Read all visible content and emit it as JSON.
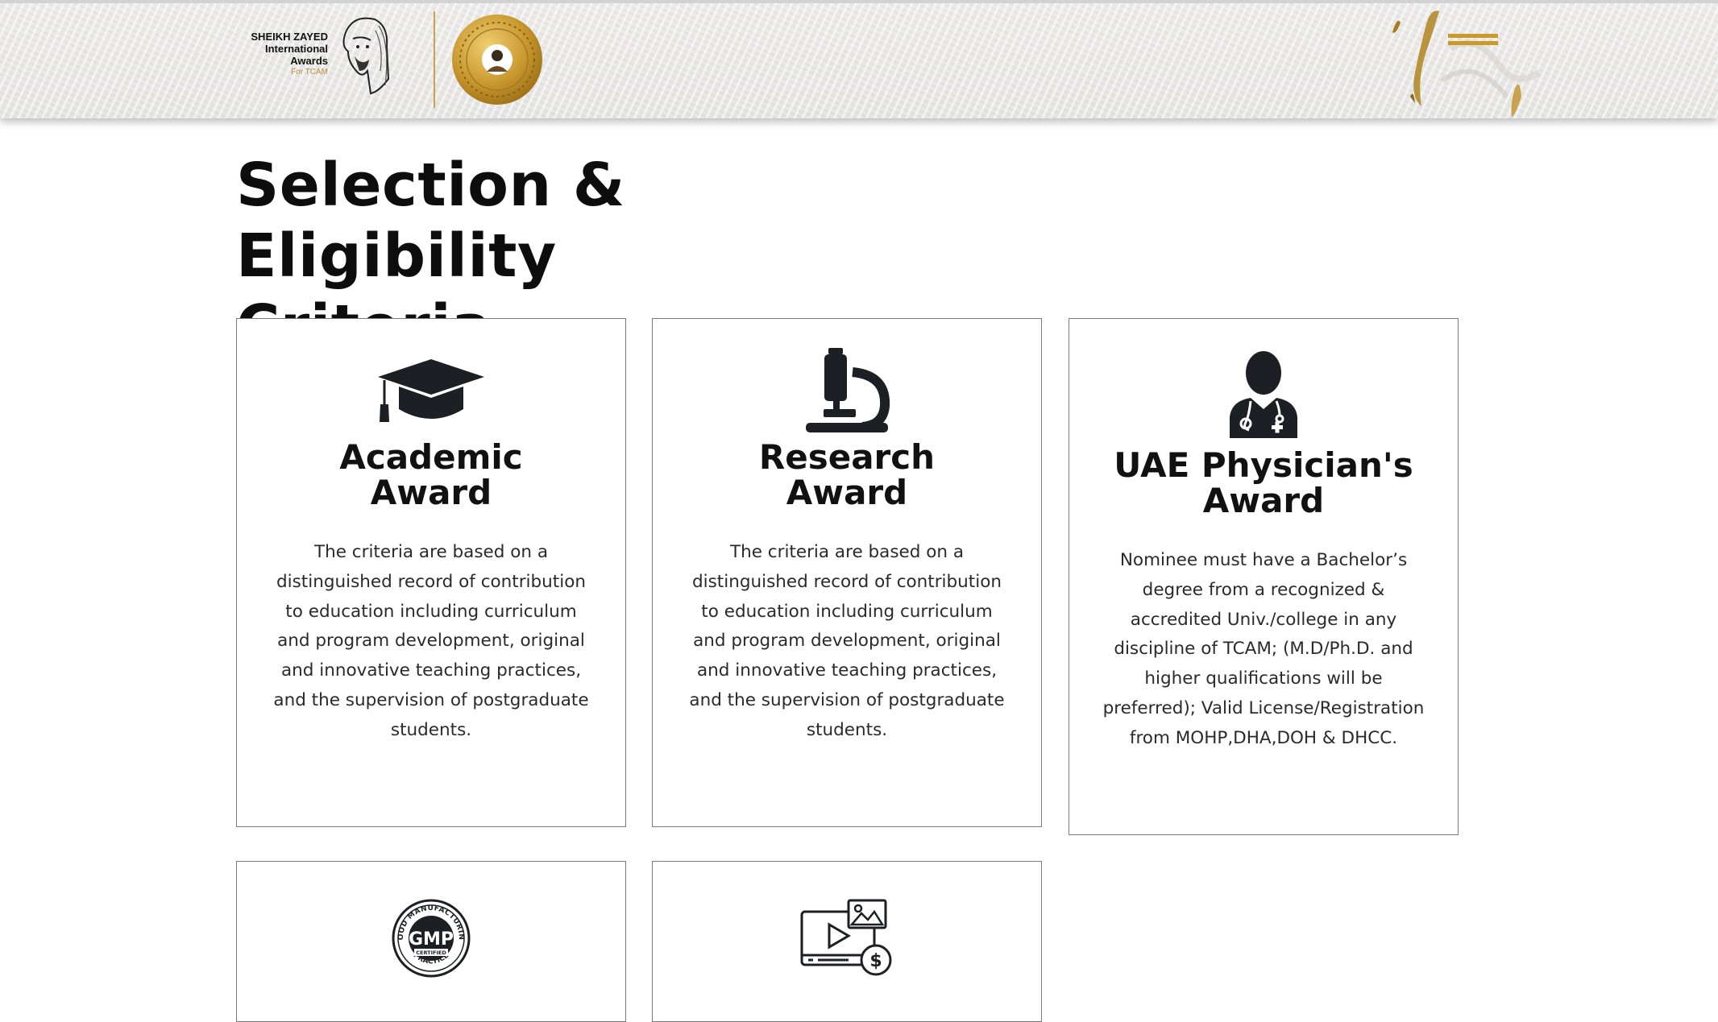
{
  "header": {
    "logo": {
      "lines": [
        "SHEIKH ZAYED",
        "International",
        "Awards"
      ],
      "sub": "For TCAM"
    },
    "colors": {
      "gold": "#c99a2a",
      "divider": "#c9a24d"
    },
    "icons": {
      "menu": "hamburger-menu-icon",
      "seal": "gold-seal-emblem"
    }
  },
  "page": {
    "title_line1": "Selection & Eligibility",
    "title_line2": "Criteria"
  },
  "cards": [
    {
      "icon": "graduation-cap-icon",
      "title_line1": "Academic",
      "title_line2": "Award",
      "text": "The criteria are based on a distinguished record of contribution to education including curriculum and program development, original and innovative teaching practices, and the supervision of postgraduate students."
    },
    {
      "icon": "microscope-icon",
      "title_line1": "Research",
      "title_line2": "Award",
      "text": "The criteria are based on a distinguished record of contribution to education including curriculum and program development, original and innovative teaching practices, and the supervision of postgraduate students."
    },
    {
      "icon": "physician-icon",
      "title_line1": "UAE Physician's",
      "title_line2": "Award",
      "text": "Nominee must have a Bachelor’s degree from a recognized & accredited Univ./college in any discipline of TCAM; (M.D/Ph.D. and higher qualifications will be preferred); Valid License/Registration from MOHP,DHA,DOH & DHCC."
    },
    {
      "icon": "gmp-certified-badge-icon",
      "badge": {
        "top_arc": "GOOD MANUFACTURING",
        "bottom_arc": "PRACTICE",
        "center": "GMP",
        "ribbon": "CERTIFIED"
      }
    },
    {
      "icon": "media-payment-icon"
    }
  ]
}
